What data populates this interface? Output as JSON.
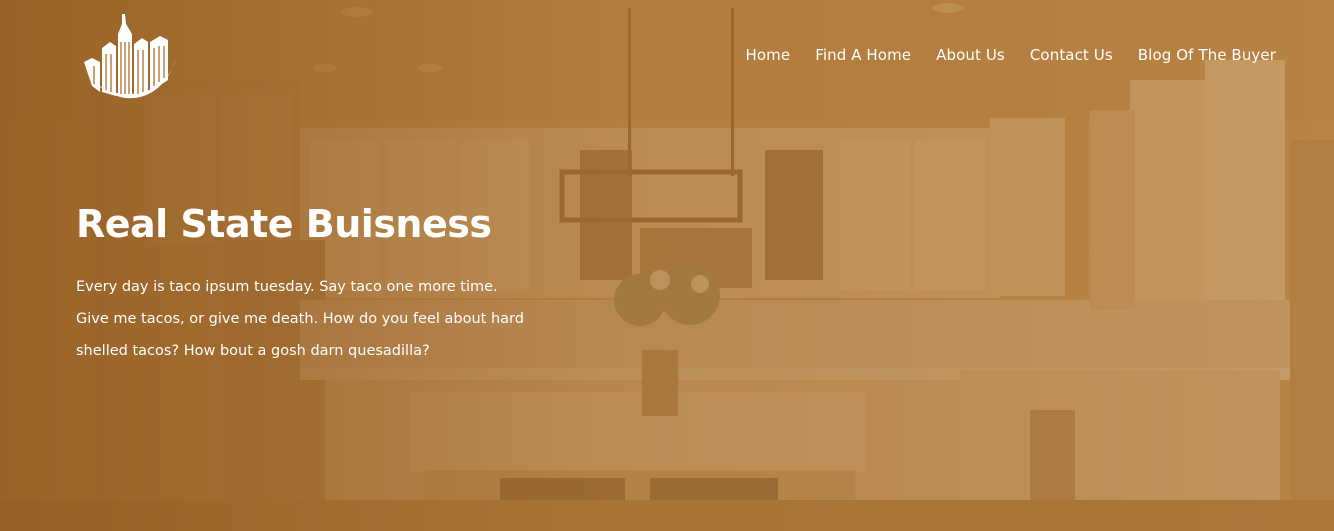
{
  "header": {
    "logo_icon": "city-skyline-icon",
    "nav": [
      {
        "label": "Home"
      },
      {
        "label": "Find A Home"
      },
      {
        "label": "About Us"
      },
      {
        "label": "Contact Us"
      },
      {
        "label": "Blog Of The Buyer"
      }
    ]
  },
  "hero": {
    "title": "Real State Buisness",
    "text_lines": [
      "Every day is taco ipsum tuesday. Say taco one more time.",
      "Give me tacos, or give me death. How do you feel about hard",
      "shelled tacos? How bout a gosh darn quesadilla?"
    ]
  },
  "colors": {
    "overlay": "#b07a3c",
    "text": "#ffffff"
  }
}
